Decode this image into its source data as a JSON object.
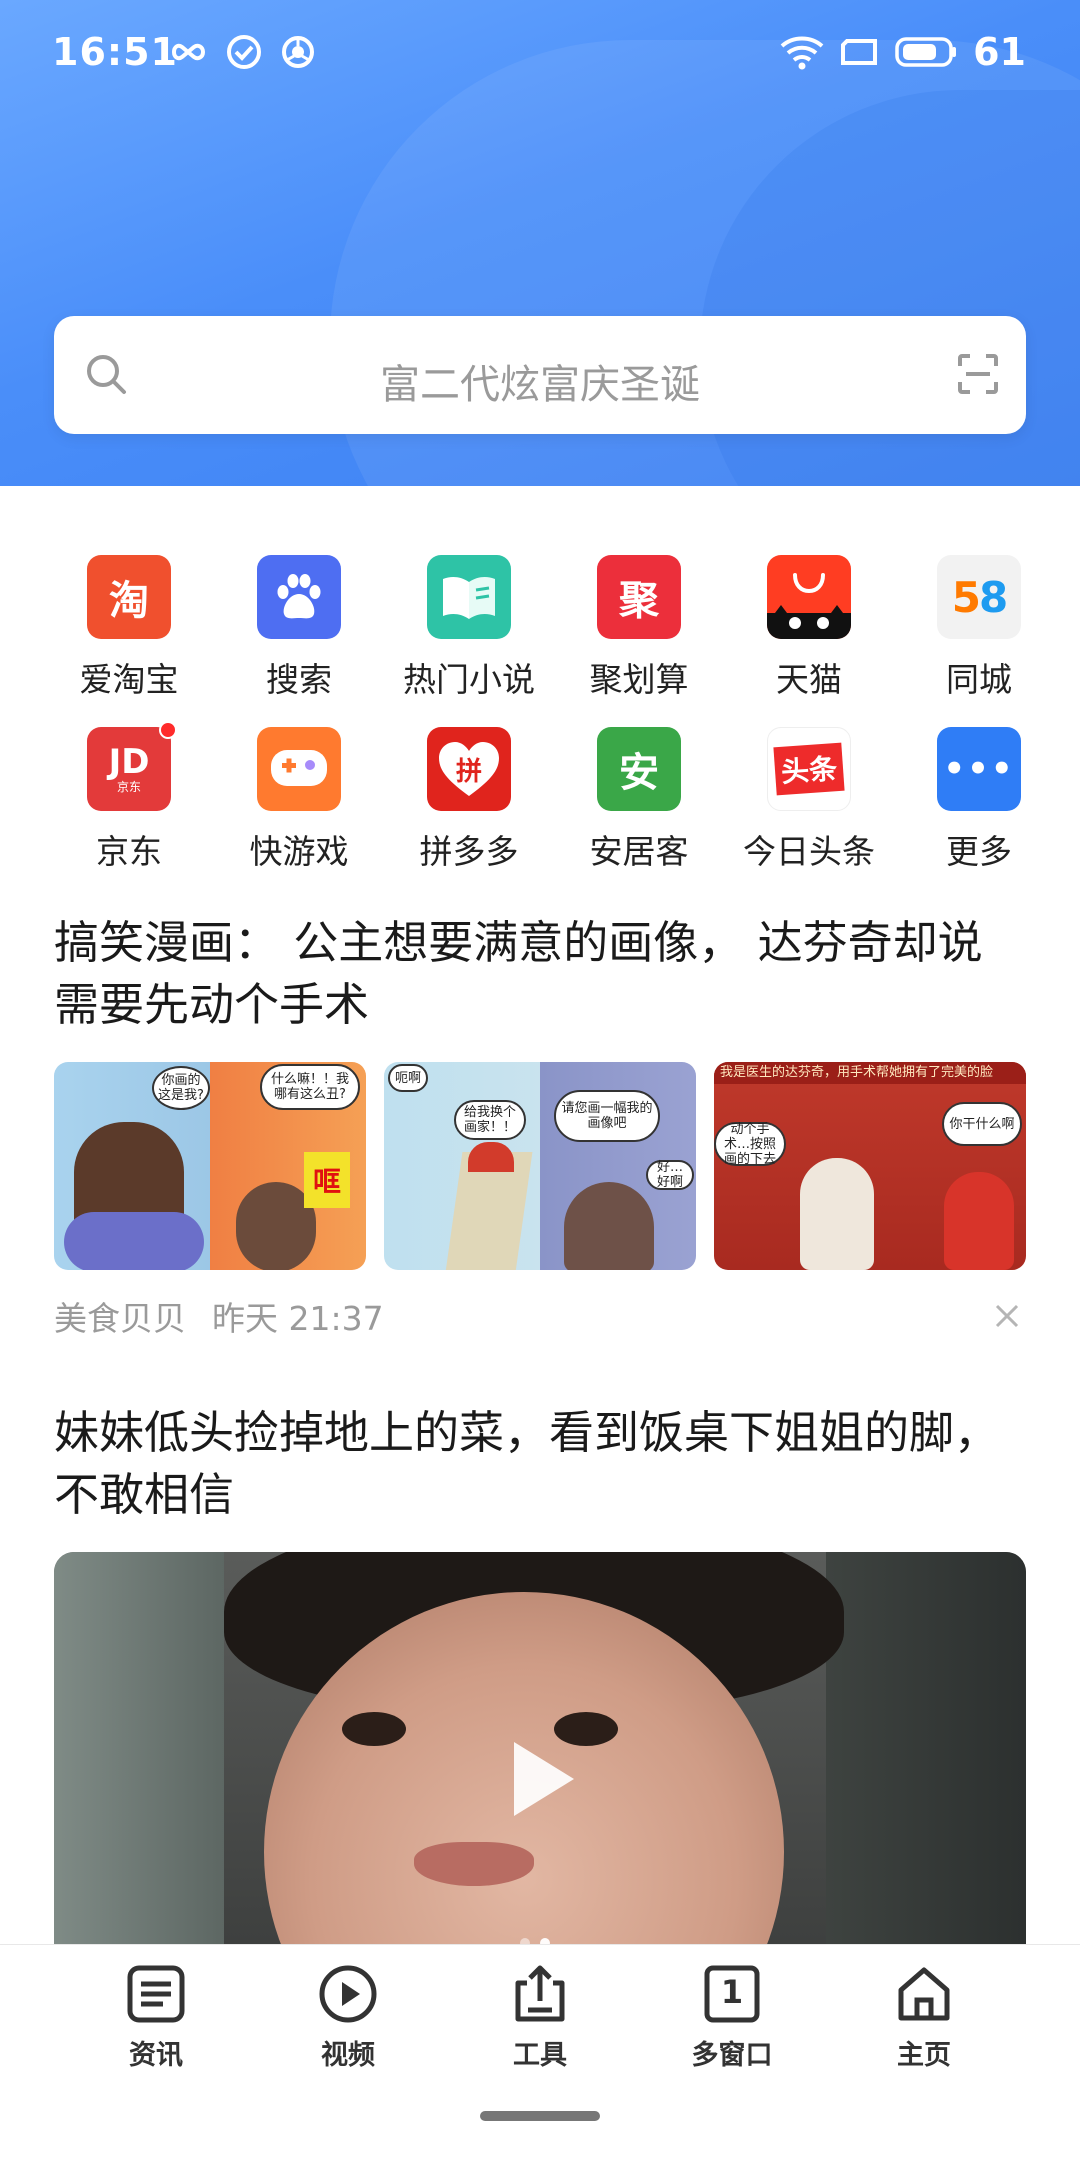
{
  "status_bar": {
    "time": "16:51",
    "battery": "61",
    "icons": [
      "infinity-icon",
      "check-circle-icon",
      "sync-icon",
      "wifi-icon",
      "screen-icon",
      "battery-icon"
    ]
  },
  "search": {
    "placeholder": "富二代炫富庆圣诞",
    "icons": [
      "search-icon",
      "scan-icon"
    ]
  },
  "apps": [
    {
      "label": "爱淘宝",
      "icon_text": "淘",
      "color": "#f0502e"
    },
    {
      "label": "搜索",
      "icon_text": "",
      "color": "#4e6ef2"
    },
    {
      "label": "热门小说",
      "icon_text": "",
      "color": "#2ec3a6"
    },
    {
      "label": "聚划算",
      "icon_text": "聚",
      "color": "#ec2f3b"
    },
    {
      "label": "天猫",
      "icon_text": "",
      "color": "#ff3d22"
    },
    {
      "label": "同城",
      "icon_text": "58",
      "color": "#f2f2f2"
    },
    {
      "label": "京东",
      "icon_text": "JD",
      "sub_text": "京东",
      "color": "#e33a3a",
      "badge": true
    },
    {
      "label": "快游戏",
      "icon_text": "",
      "color": "#ff7a2f"
    },
    {
      "label": "拼多多",
      "icon_text": "拼",
      "color": "#e0241d"
    },
    {
      "label": "安居客",
      "icon_text": "安",
      "color": "#3aa748"
    },
    {
      "label": "今日头条",
      "icon_text": "头条",
      "color": "#ffffff"
    },
    {
      "label": "更多",
      "icon_text": "•••",
      "color": "#2f7df6"
    }
  ],
  "feed": [
    {
      "title": "搞笑漫画： 公主想要满意的画像， 达芬奇却说需要先动个手术",
      "source": "美食贝贝",
      "time": "昨天 21:37",
      "comic_bubbles": [
        [
          "你画的这是我?",
          "什么嘛！！我哪有这么丑?",
          "哐"
        ],
        [
          "呃啊",
          "给我换个画家！！",
          "请您画一幅我的画像吧",
          "好…好啊"
        ],
        [
          "我是医生的达芬奇，用手术帮她拥有了完美的脸",
          "动个手术…按照画的下去",
          "你干什么啊"
        ]
      ]
    },
    {
      "title": "妹妹低头捡掉地上的菜，看到饭桌下姐姐的脚，不敢相信"
    }
  ],
  "bottom_nav": [
    {
      "label": "资讯",
      "icon": "news-icon"
    },
    {
      "label": "视频",
      "icon": "play-circle-icon"
    },
    {
      "label": "工具",
      "icon": "tools-icon"
    },
    {
      "label": "多窗口",
      "icon": "windows-icon",
      "count": "1"
    },
    {
      "label": "主页",
      "icon": "home-icon"
    }
  ],
  "colors": {
    "header_blue": "#4a8ef9",
    "text_dark": "#1a1a1a",
    "text_gray": "#9a9a9a"
  }
}
